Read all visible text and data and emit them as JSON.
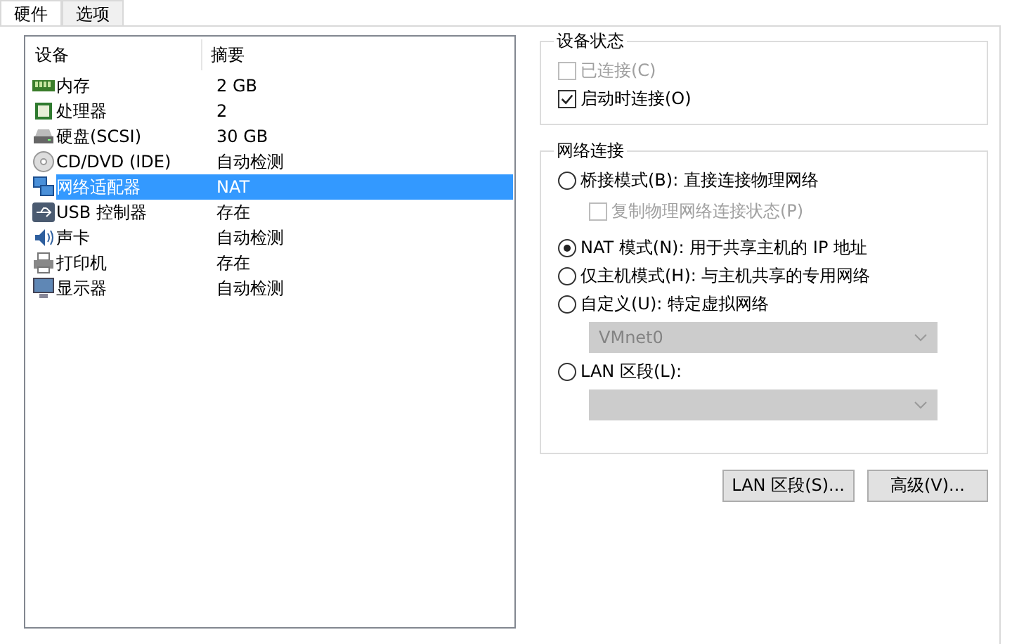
{
  "tabs": [
    {
      "label": "硬件",
      "selected": true
    },
    {
      "label": "选项",
      "selected": false
    }
  ],
  "device_list": {
    "columns": [
      "设备",
      "摘要"
    ],
    "rows": [
      {
        "kind": "memory",
        "device": "内存",
        "summary": "2 GB",
        "selected": false
      },
      {
        "kind": "cpu",
        "device": "处理器",
        "summary": "2",
        "selected": false
      },
      {
        "kind": "disk",
        "device": "硬盘(SCSI)",
        "summary": "30 GB",
        "selected": false
      },
      {
        "kind": "cdrom",
        "device": "CD/DVD (IDE)",
        "summary": "自动检测",
        "selected": false
      },
      {
        "kind": "network",
        "device": "网络适配器",
        "summary": "NAT",
        "selected": true
      },
      {
        "kind": "usb",
        "device": "USB 控制器",
        "summary": "存在",
        "selected": false
      },
      {
        "kind": "sound",
        "device": "声卡",
        "summary": "自动检测",
        "selected": false
      },
      {
        "kind": "printer",
        "device": "打印机",
        "summary": "存在",
        "selected": false
      },
      {
        "kind": "display",
        "device": "显示器",
        "summary": "自动检测",
        "selected": false
      }
    ]
  },
  "device_status": {
    "title": "设备状态",
    "items": [
      {
        "label": "已连接(C)",
        "checked": false,
        "disabled": true
      },
      {
        "label": "启动时连接(O)",
        "checked": true,
        "disabled": false
      }
    ]
  },
  "network_connection": {
    "title": "网络连接",
    "items": [
      {
        "kind": "radio",
        "label": "桥接模式(B): 直接连接物理网络",
        "selected": false
      },
      {
        "kind": "checkbox",
        "label": "复制物理网络连接状态(P)",
        "checked": false,
        "disabled": true
      },
      {
        "kind": "radio",
        "label": "NAT 模式(N): 用于共享主机的 IP 地址",
        "selected": true
      },
      {
        "kind": "radio",
        "label": "仅主机模式(H): 与主机共享的专用网络",
        "selected": false
      },
      {
        "kind": "radio",
        "label": "自定义(U): 特定虚拟网络",
        "selected": false
      },
      {
        "kind": "dropdown",
        "value": "VMnet0",
        "disabled": true
      },
      {
        "kind": "radio",
        "label": "LAN 区段(L):",
        "selected": false
      },
      {
        "kind": "dropdown",
        "disabled": true
      }
    ]
  },
  "buttons": [
    "LAN 区段(S)...",
    "高级(V)..."
  ]
}
